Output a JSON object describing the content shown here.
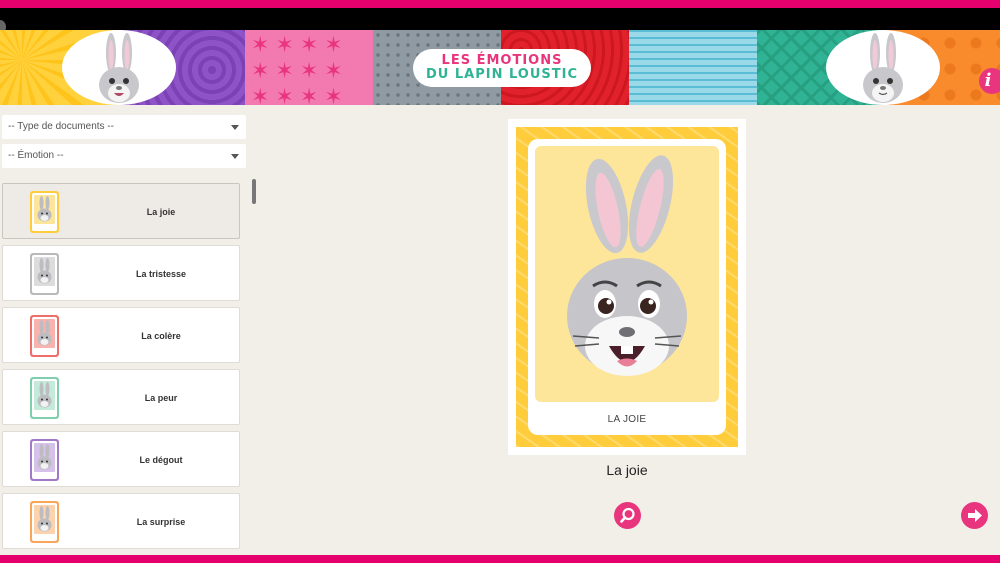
{
  "header": {
    "logo_line1": "LES ÉMOTIONS",
    "logo_line2": "DU LAPIN LOUSTIC",
    "info_icon": "info-icon",
    "info_glyph": "i"
  },
  "filters": {
    "document_type": "-- Type de documents --",
    "emotion": "-- Émotion --"
  },
  "emotions": [
    {
      "label": "La joie",
      "color": "#ffcd3c",
      "pane": "#fde59a",
      "active": true
    },
    {
      "label": "La tristesse",
      "color": "#b9b9b9",
      "pane": "#dcdcdc",
      "active": false
    },
    {
      "label": "La colère",
      "color": "#ee6f6a",
      "pane": "#f8b3ae",
      "active": false
    },
    {
      "label": "La peur",
      "color": "#7fcfae",
      "pane": "#c4ead9",
      "active": false
    },
    {
      "label": "Le dégout",
      "color": "#a278c9",
      "pane": "#d6c1ea",
      "active": false
    },
    {
      "label": "La surprise",
      "color": "#f9a55a",
      "pane": "#fcd3ad",
      "active": false
    }
  ],
  "viewer": {
    "card_caption": "LA JOIE",
    "title": "La joie"
  },
  "colors": {
    "brand_pink": "#e5006d",
    "accent_pink": "#e8357d",
    "background": "#f2eee8"
  },
  "icons": {
    "zoom": "magnifier-icon",
    "next": "arrow-right-icon",
    "dropdown": "caret-down-icon"
  }
}
